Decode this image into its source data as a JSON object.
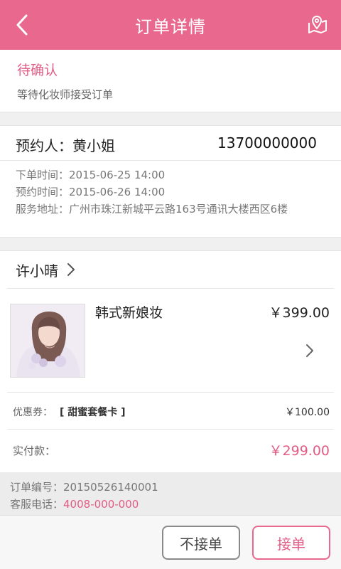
{
  "colors": {
    "header_bg": "#e9698e",
    "accent_text": "#e35c86",
    "page_bg": "#f0f0f0"
  },
  "header": {
    "title": "订单详情",
    "back_icon": "chevron-left-icon",
    "map_icon": "map-pin-icon"
  },
  "status": {
    "title": "待确认",
    "description": "等待化妆师接受订单"
  },
  "contact": {
    "name_text": "预约人：黄小姐",
    "phone": "13700000000",
    "order_time": "下单时间：2015-06-25 14:00",
    "appointment_time": "预约时间：2015-06-26 14:00",
    "address": "服务地址：广州市珠江新城平云路163号通讯大楼西区6楼"
  },
  "order": {
    "artist_name": "许小晴",
    "product_name": "韩式新娘妆",
    "product_price": "￥399.00",
    "coupon_label": "优惠券：",
    "coupon_name": "[ 甜蜜套餐卡 ]",
    "coupon_value": "￥100.00",
    "paid_label": "实付款：",
    "paid_value": "￥299.00"
  },
  "meta": {
    "order_number_text": "订单编号：20150526140001",
    "service_phone_label": "客服电话：",
    "service_phone": "4008-000-000"
  },
  "actions": {
    "reject_label": "不接单",
    "accept_label": "接单"
  }
}
